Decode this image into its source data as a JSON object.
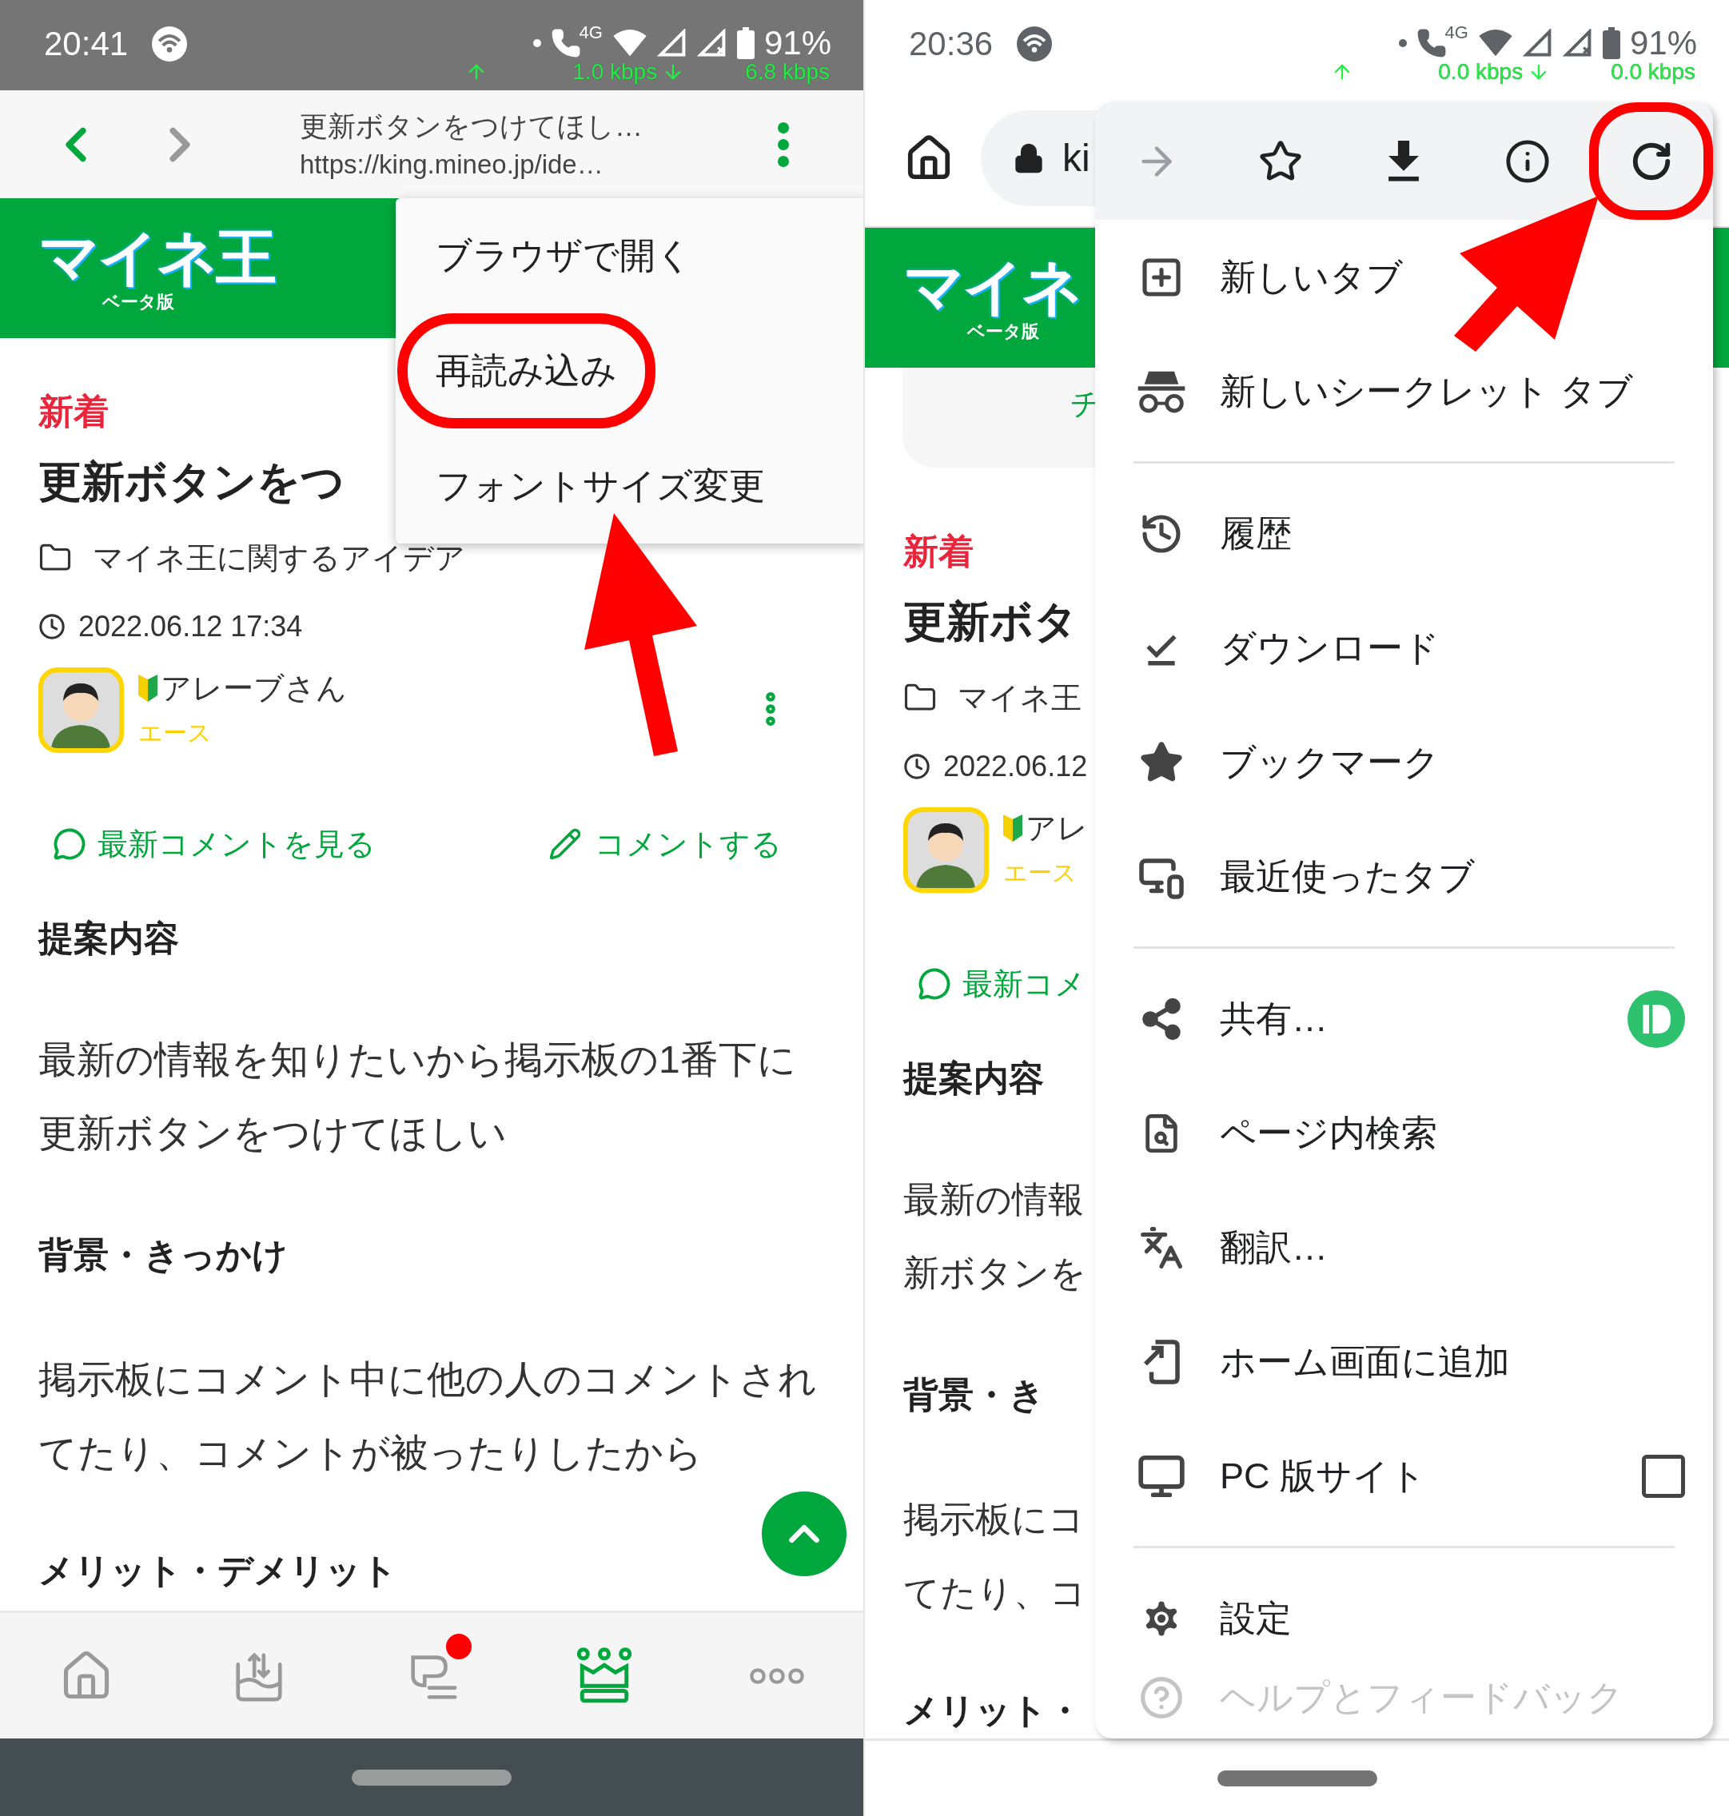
{
  "left_screen": {
    "status_bar": {
      "time": "20:41",
      "network_label": "4G",
      "battery": "91%",
      "upload_rate": "1.0 kbps",
      "download_rate": "6.8 kbps"
    },
    "toolbar": {
      "title": "更新ボタンをつけてほし…",
      "url": "https://king.mineo.jp/ide…"
    },
    "header": {
      "logo": "マイネ王",
      "logo_caption": "ベータ版"
    },
    "post": {
      "badge": "新着",
      "title": "更新ボタンをつ",
      "category": "マイネ王に関するアイデア",
      "date": "2022.06.12 17:34",
      "author": "アレーブさん",
      "rank": "エース",
      "latest_comments_link": "最新コメントを見る",
      "comment_link": "コメントする"
    },
    "sections": [
      {
        "heading": "提案内容",
        "body": "最新の情報を知りたいから掲示板の1番下に更新ボタンをつけてほしい"
      },
      {
        "heading": "背景・きっかけ",
        "body": "掲示板にコメント中に他の人のコメントされてたり、コメントが被ったりしたから"
      },
      {
        "heading": "メリット・デメリット"
      }
    ],
    "menu": {
      "items": [
        {
          "label": "ブラウザで開く",
          "annotated": false
        },
        {
          "label": "再読み込み",
          "annotated": true
        },
        {
          "label": "フォントサイズ変更",
          "annotated": false
        }
      ]
    },
    "bottom_nav": [
      {
        "selected": false,
        "notification": false
      },
      {
        "selected": false,
        "notification": false
      },
      {
        "selected": false,
        "notification": true
      },
      {
        "selected": true,
        "notification": false
      },
      {
        "selected": false,
        "notification": false
      }
    ]
  },
  "right_screen": {
    "status_bar": {
      "time": "20:36",
      "network_label": "4G",
      "battery": "91%",
      "upload_rate": "0.0 kbps",
      "download_rate": "0.0 kbps"
    },
    "toolbar": {
      "url": "ki"
    },
    "header": {
      "logo": "マイネ",
      "logo_caption": "ベータ版"
    },
    "card_text": "チ",
    "post": {
      "badge": "新着",
      "title": "更新ボタ",
      "category": "マイネ王",
      "date": "2022.06.12",
      "author": "アレ",
      "rank": "エース",
      "latest_comments_link": "最新コメ"
    },
    "sections": [
      {
        "heading": "提案内容",
        "body_lines": [
          "最新の情報",
          "新ボタンを"
        ]
      },
      {
        "heading": "背景・き",
        "body_lines": [
          "掲示板にコ",
          "てたり、コ"
        ]
      },
      {
        "heading": "メリット・"
      }
    ],
    "menu": {
      "actions": [
        {
          "disabled": true,
          "annotated": false
        },
        {
          "disabled": false,
          "annotated": false
        },
        {
          "disabled": false,
          "annotated": false
        },
        {
          "disabled": false,
          "annotated": false
        },
        {
          "disabled": false,
          "annotated": true
        }
      ],
      "items": [
        {
          "kind": "item",
          "label": "新しいタブ"
        },
        {
          "kind": "item",
          "label": "新しいシークレット タブ"
        },
        {
          "kind": "divider"
        },
        {
          "kind": "item",
          "label": "履歴"
        },
        {
          "kind": "item",
          "label": "ダウンロード"
        },
        {
          "kind": "item",
          "label": "ブックマーク"
        },
        {
          "kind": "item",
          "label": "最近使ったタブ"
        },
        {
          "kind": "divider"
        },
        {
          "kind": "item",
          "label": "共有…",
          "badge": true
        },
        {
          "kind": "item",
          "label": "ページ内検索"
        },
        {
          "kind": "item",
          "label": "翻訳…"
        },
        {
          "kind": "item",
          "label": "ホーム画面に追加"
        },
        {
          "kind": "checkbox",
          "label": "PC 版サイト",
          "checked": false
        },
        {
          "kind": "divider"
        },
        {
          "kind": "item",
          "label": "設定"
        },
        {
          "kind": "item",
          "label": "ヘルプとフィードバック",
          "faded": true
        }
      ]
    }
  }
}
